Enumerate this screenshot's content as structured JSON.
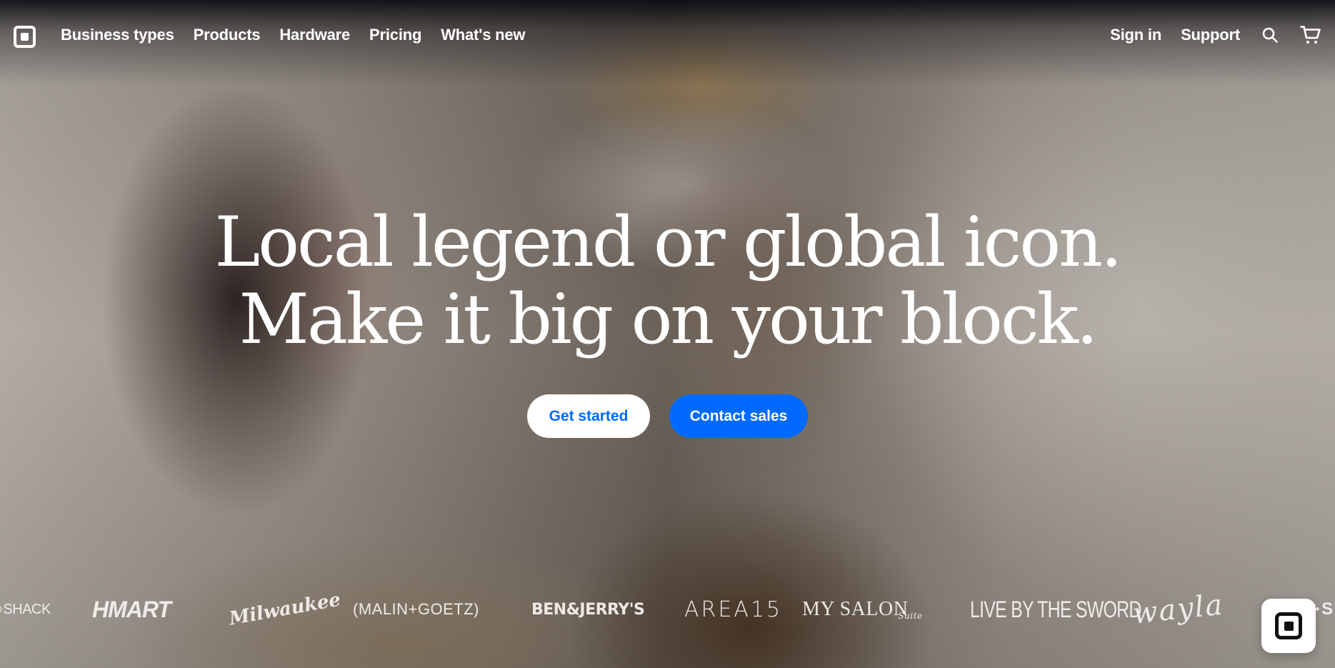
{
  "nav": {
    "left_items": [
      "Business types",
      "Products",
      "Hardware",
      "Pricing",
      "What's new"
    ],
    "sign_in": "Sign in",
    "support": "Support",
    "icons": {
      "logo": "square-logo-icon",
      "search": "search-icon",
      "cart": "cart-icon"
    }
  },
  "hero": {
    "headline_line1": "Local legend or global icon.",
    "headline_line2": "Make it big on your block.",
    "cta_primary": "Get started",
    "cta_secondary": "Contact sales"
  },
  "brands": {
    "shack": "SHACK",
    "hmart": "HMART",
    "milwaukee": "Milwaukee",
    "malin_goetz": "(MALIN+GOETZ)",
    "ben_jerrys": "BEN&JERRY'S",
    "area15": "AREA15",
    "my_salon": "MY SALON",
    "my_salon_sub": "Suite",
    "live_by_the_sword": "LIVE BY THE SWORD",
    "wayla": "wayla",
    "edge": "S"
  },
  "colors": {
    "accent_blue": "#006aff",
    "white": "#ffffff"
  },
  "floating_button": {
    "icon": "square-logo-icon"
  }
}
